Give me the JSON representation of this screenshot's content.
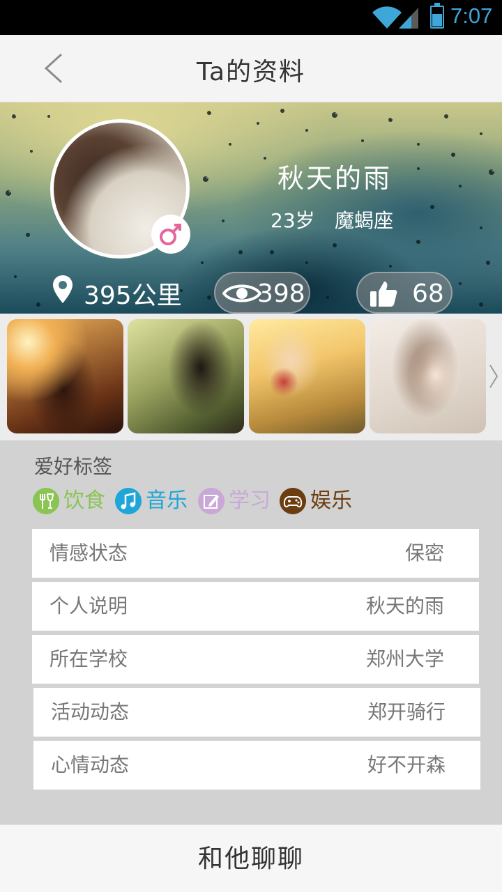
{
  "status_bar": {
    "time": "7:07"
  },
  "header": {
    "title": "Ta的资料"
  },
  "profile": {
    "nickname": "秋天的雨",
    "age": "23岁",
    "zodiac": "魔蝎座",
    "distance": "395公里",
    "views": "398",
    "likes": "68",
    "gender_symbol": "♂",
    "gender_color": "#e4669a"
  },
  "hobbies": {
    "title": "爱好标签",
    "tags": [
      {
        "label": "饮食",
        "color": "#8ac453",
        "icon": "fork-glass-icon"
      },
      {
        "label": "音乐",
        "color": "#1fa6d8",
        "icon": "music-note-icon"
      },
      {
        "label": "学习",
        "color": "#c9a8d8",
        "icon": "pencil-note-icon"
      },
      {
        "label": "娱乐",
        "color": "#6b3d10",
        "icon": "gamepad-icon"
      }
    ]
  },
  "info": [
    {
      "label": "情感状态",
      "value": "保密"
    },
    {
      "label": "个人说明",
      "value": "秋天的雨"
    },
    {
      "label": "所在学校",
      "value": "郑州大学"
    },
    {
      "label": "活动动态",
      "value": "郑开骑行"
    },
    {
      "label": "心情动态",
      "value": "好不开森"
    }
  ],
  "actions": {
    "chat_label": "和他聊聊"
  }
}
